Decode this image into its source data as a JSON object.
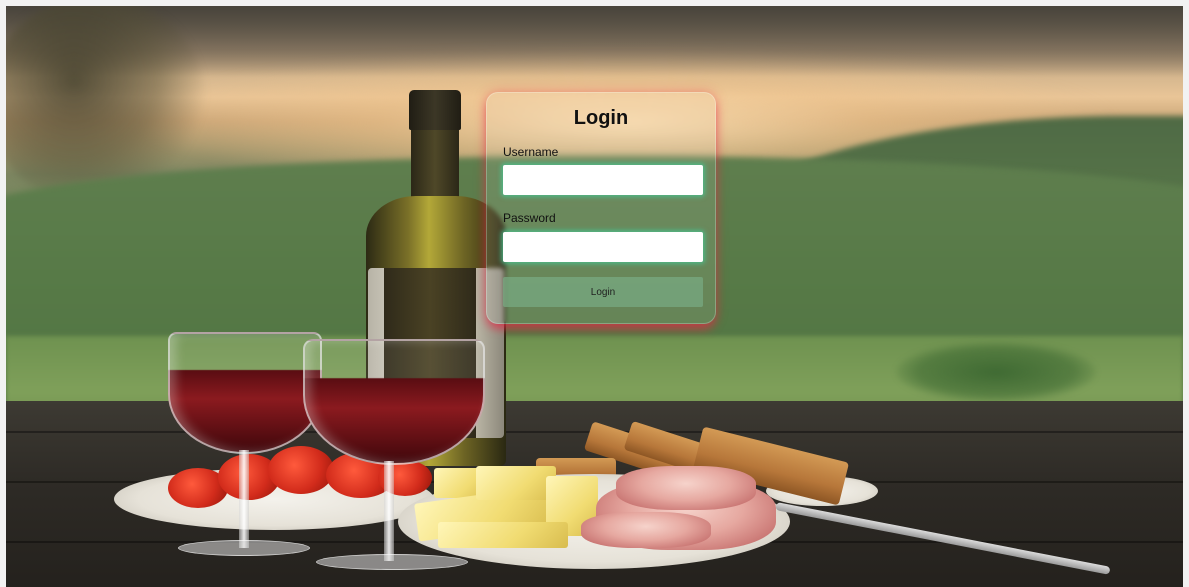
{
  "login": {
    "title": "Login",
    "username_label": "Username",
    "username_value": "",
    "password_label": "Password",
    "password_value": "",
    "submit_label": "Login"
  },
  "colors": {
    "card_glow": "#e62846",
    "input_glow": "#46c896",
    "button_bg": "#78aa82"
  }
}
